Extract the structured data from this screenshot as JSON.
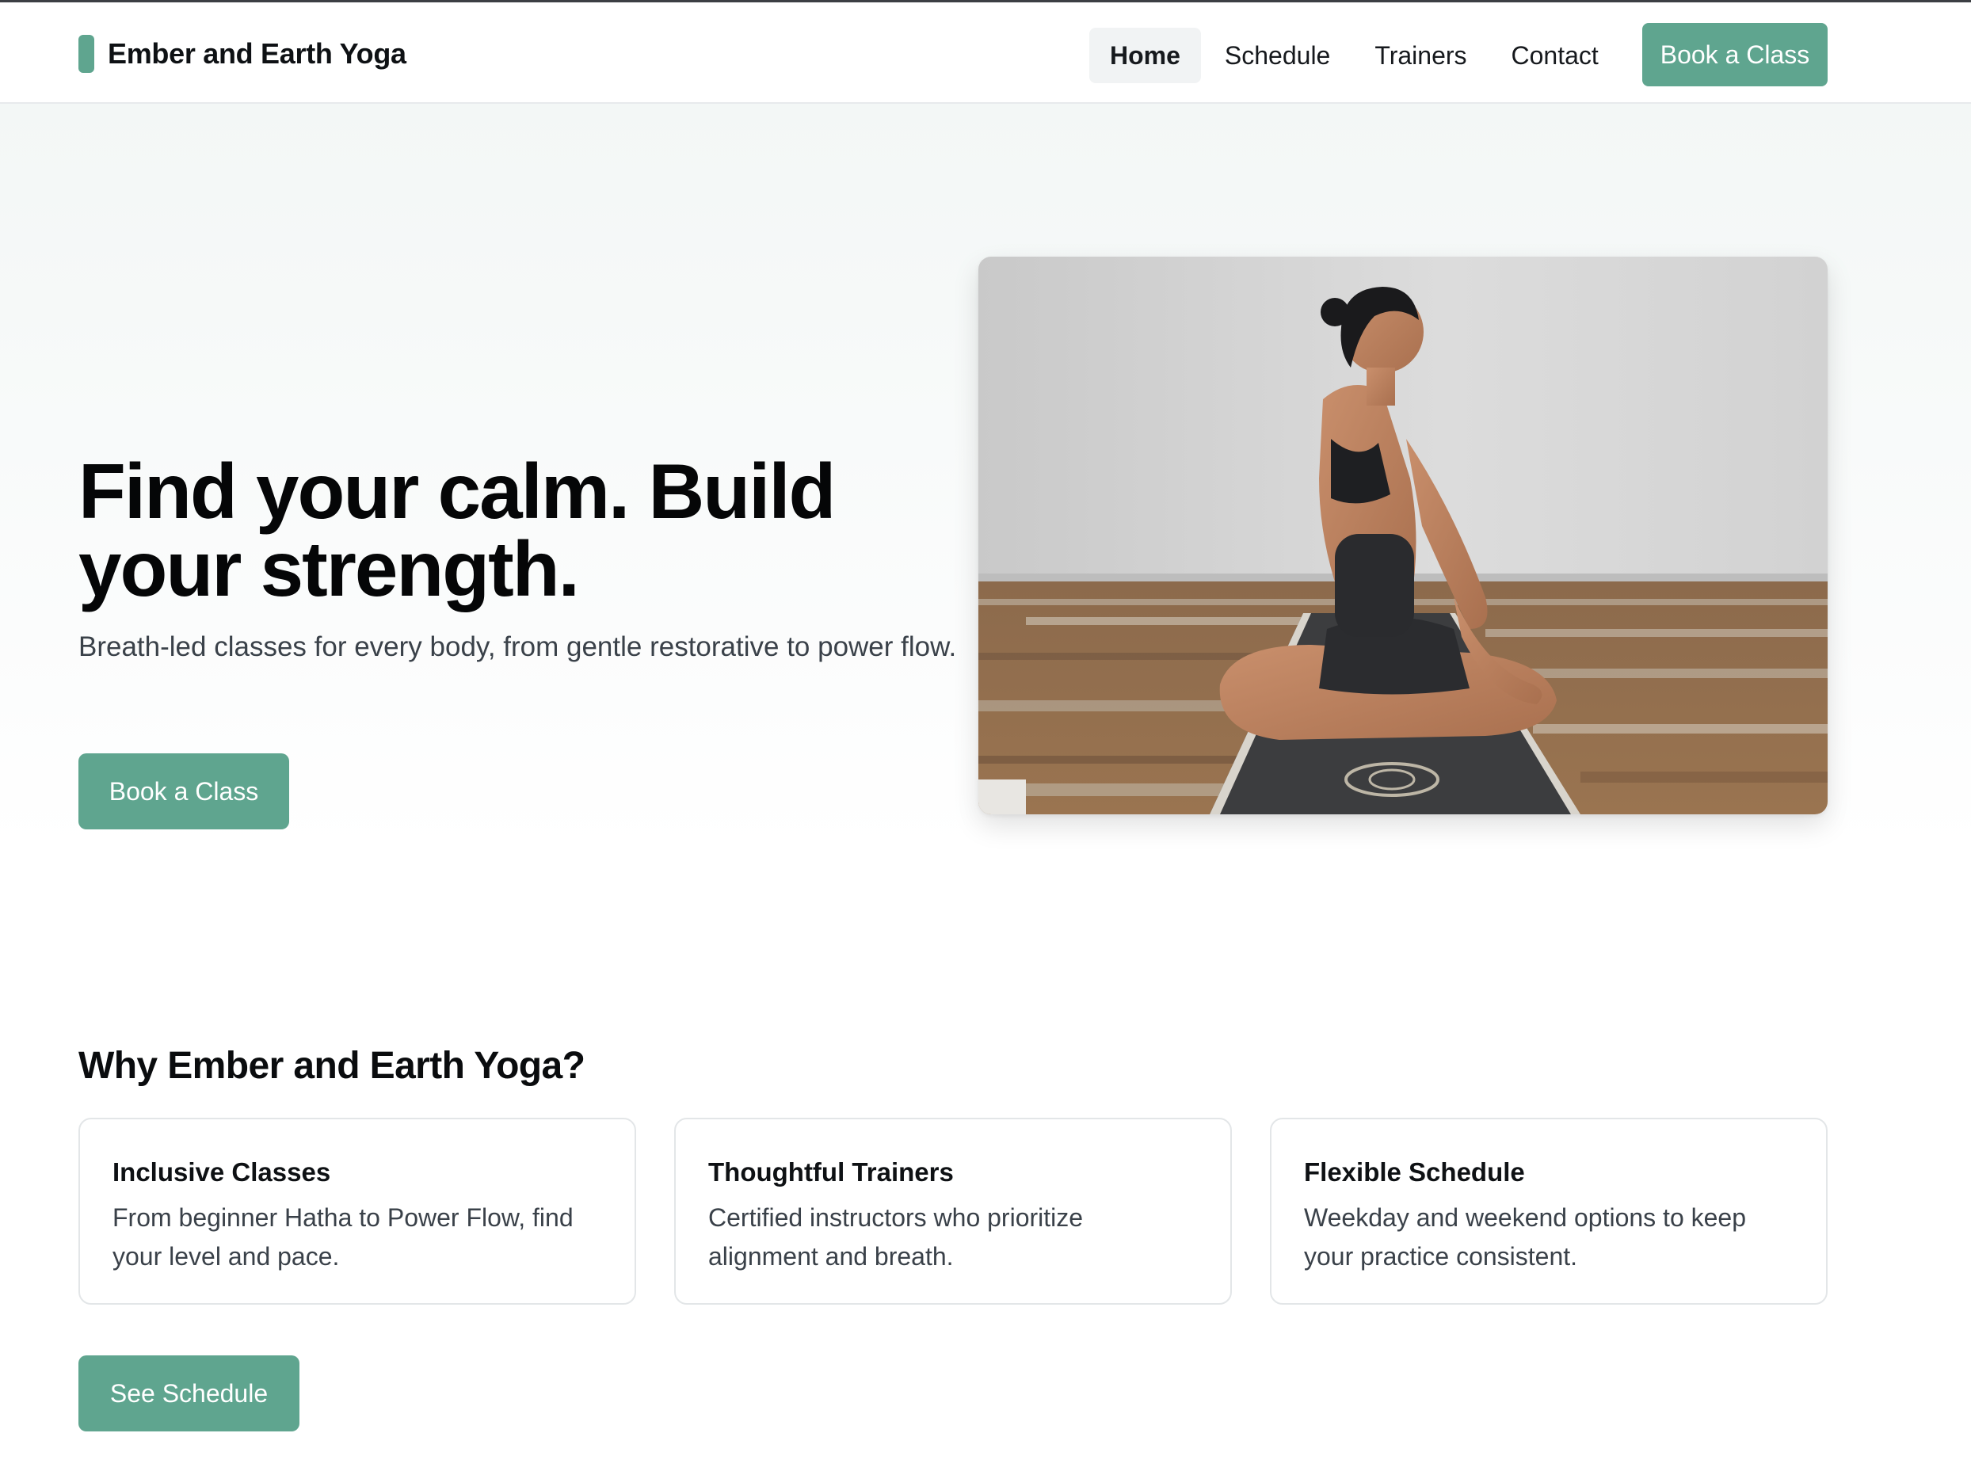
{
  "brand": {
    "name": "Ember and Earth Yoga"
  },
  "nav": {
    "items": [
      {
        "label": "Home",
        "active": true
      },
      {
        "label": "Schedule",
        "active": false
      },
      {
        "label": "Trainers",
        "active": false
      },
      {
        "label": "Contact",
        "active": false
      }
    ],
    "cta_label": "Book a Class"
  },
  "hero": {
    "title": "Find your calm. Build your strength.",
    "subtitle": "Breath-led classes for every body, from gentle restorative to power flow.",
    "cta_label": "Book a Class"
  },
  "features": {
    "title": "Why Ember and Earth Yoga?",
    "cards": [
      {
        "title": "Inclusive Classes",
        "body": "From beginner Hatha to Power Flow, find your level and pace."
      },
      {
        "title": "Thoughtful Trainers",
        "body": "Certified instructors who prioritize alignment and breath."
      },
      {
        "title": "Flexible Schedule",
        "body": "Weekday and weekend options to keep your practice consistent."
      }
    ],
    "cta_label": "See Schedule"
  },
  "colors": {
    "accent": "#5fa58f",
    "text": "#111418",
    "muted_text": "#3a4149",
    "active_nav_bg": "#f1f3f4"
  }
}
